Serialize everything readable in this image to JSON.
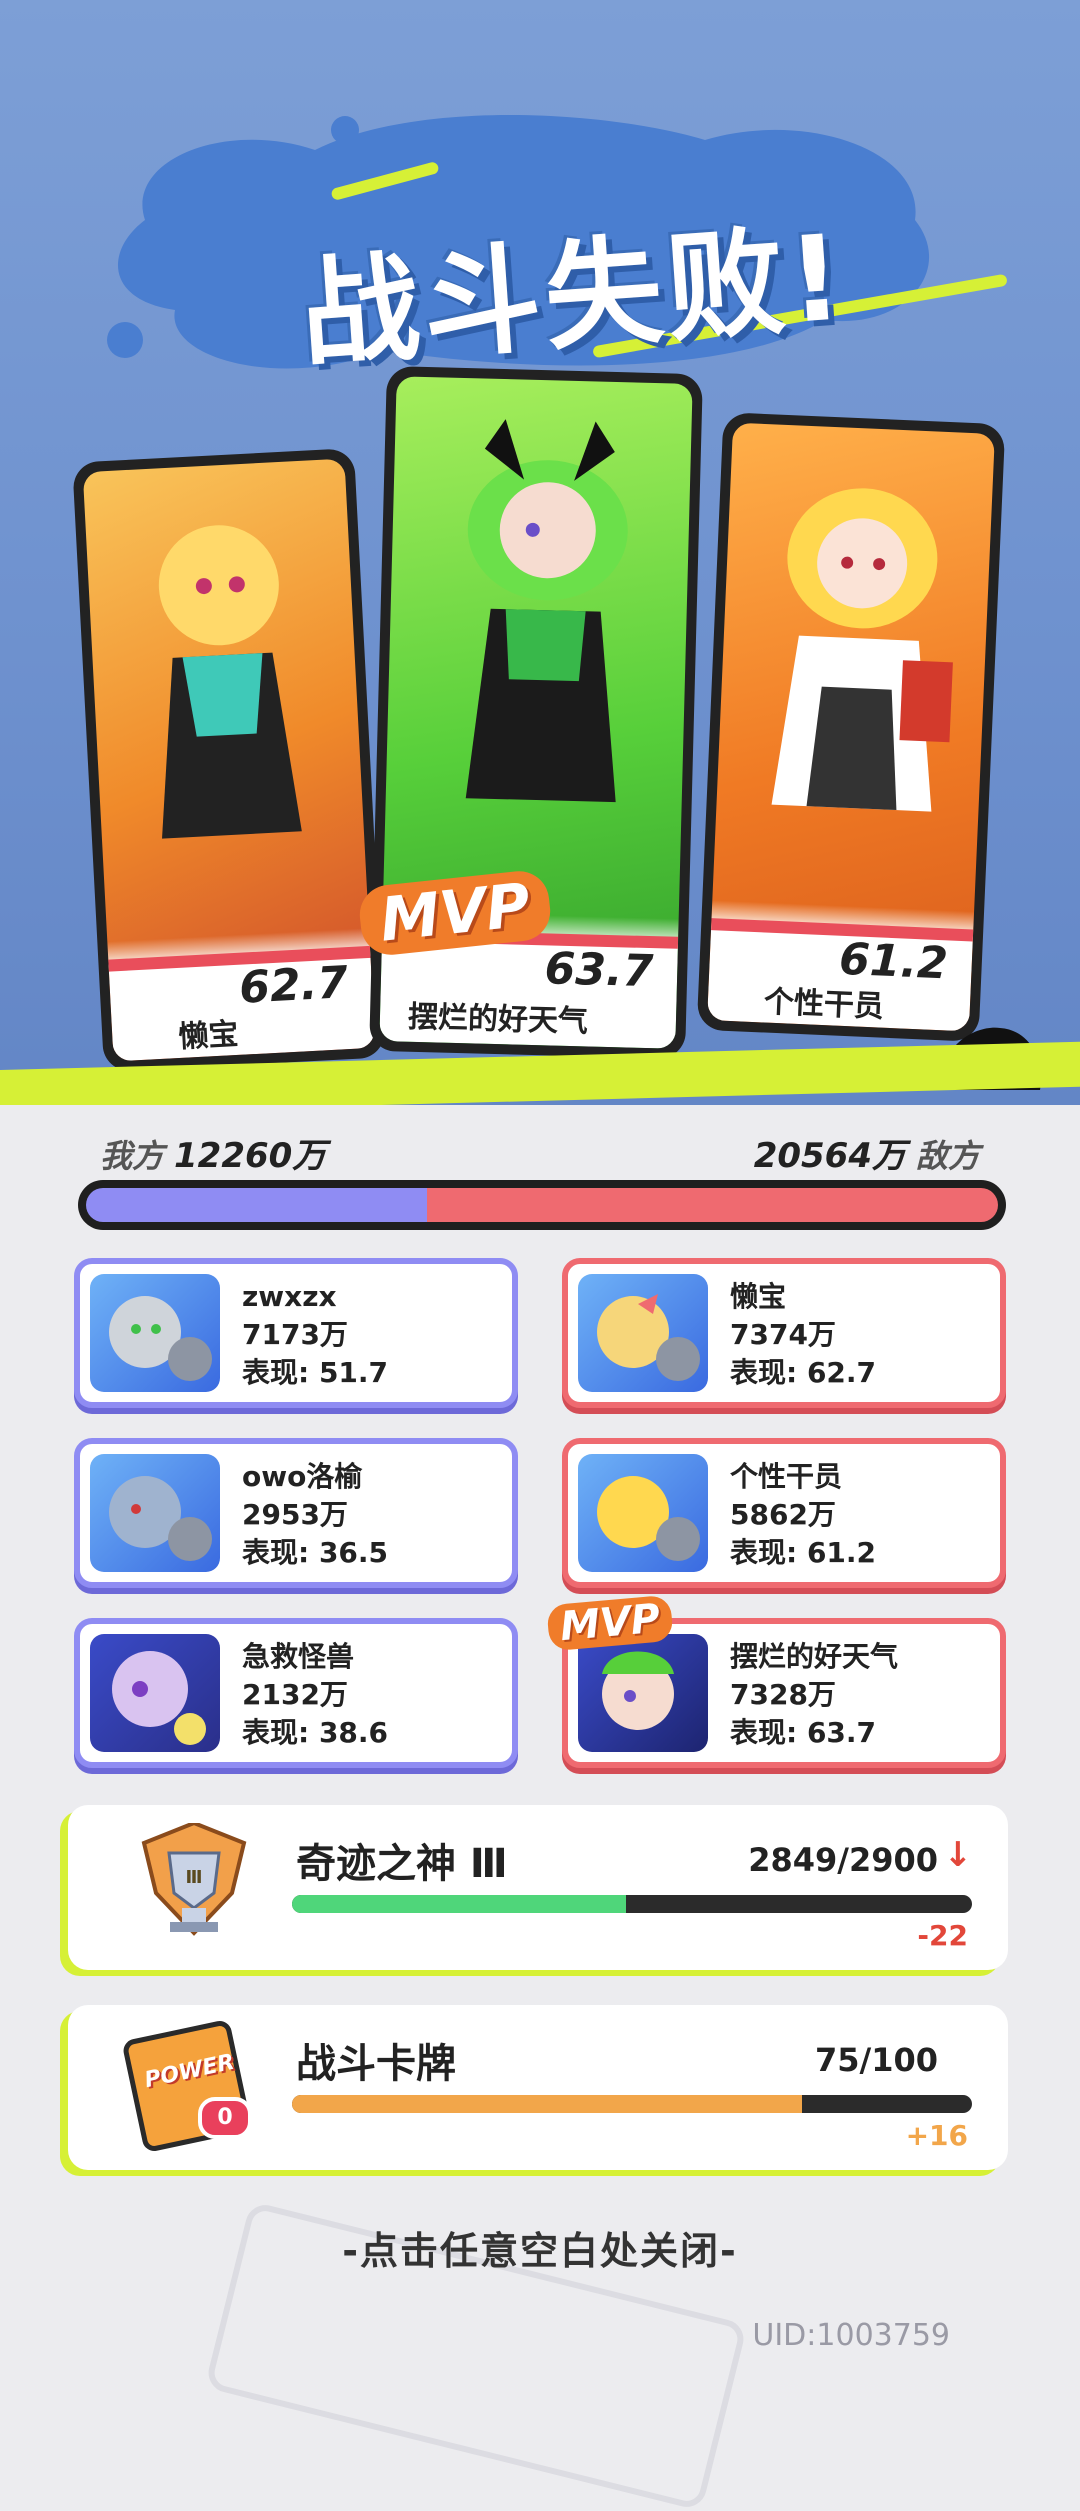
{
  "header": {
    "title": "战斗失败!"
  },
  "cards": [
    {
      "name": "懒宝",
      "score": "62.7",
      "mvp": false
    },
    {
      "name": "摆烂的好天气",
      "score": "63.7",
      "mvp": true
    },
    {
      "name": "个性干员",
      "score": "61.2",
      "mvp": false
    }
  ],
  "mvp_label": "MVP",
  "score_summary": {
    "our_label": "我方",
    "our_score": "12260万",
    "enemy_label": "敌方",
    "enemy_score": "20564万",
    "our_share": 0.374
  },
  "our_team": [
    {
      "name": "zwxzx",
      "damage": "7173万",
      "performance": "表现: 51.7"
    },
    {
      "name": "owo洛榆",
      "damage": "2953万",
      "performance": "表现: 36.5"
    },
    {
      "name": "急救怪兽",
      "damage": "2132万",
      "performance": "表现: 38.6"
    }
  ],
  "enemy_team": [
    {
      "name": "懒宝",
      "damage": "7374万",
      "performance": "表现: 62.7",
      "mvp": false
    },
    {
      "name": "个性干员",
      "damage": "5862万",
      "performance": "表现: 61.2",
      "mvp": false
    },
    {
      "name": "摆烂的好天气",
      "damage": "7328万",
      "performance": "表现: 63.7",
      "mvp": true
    }
  ],
  "rank": {
    "title": "奇迹之神 Ⅲ",
    "progress_text": "2849/2900",
    "progress": 0.491,
    "delta": "-22",
    "trend_icon": "arrow-down-icon",
    "fill_color": "#4fd67a"
  },
  "battle_card": {
    "title": "战斗卡牌",
    "progress_text": "75/100",
    "progress": 0.75,
    "delta": "+16",
    "fill_color": "#f2a64a",
    "badge_count": "0",
    "card_logo": "POWER"
  },
  "footer": {
    "close_hint": "-点击任意空白处关闭-",
    "uid": "UID:1003759"
  },
  "colors": {
    "our_team": "#8f8cf3",
    "enemy_team": "#ef6a70",
    "accent_lime": "#d6f036"
  }
}
